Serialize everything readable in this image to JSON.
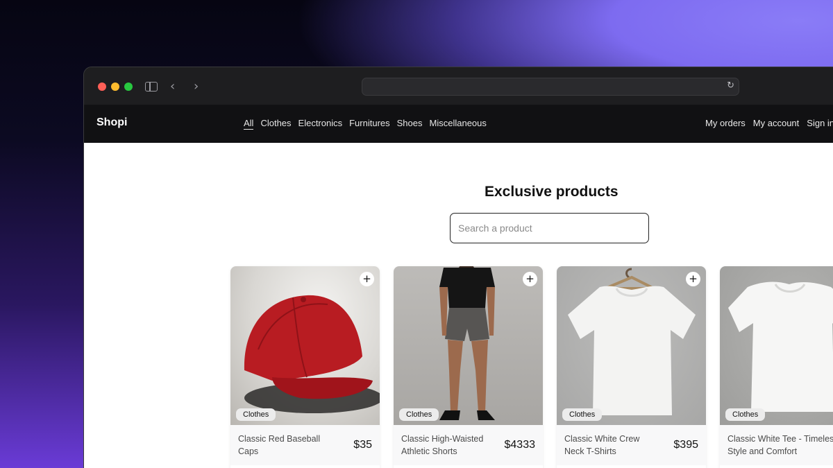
{
  "nav": {
    "logo": "Shopi",
    "categories": [
      {
        "label": "All",
        "active": true
      },
      {
        "label": "Clothes"
      },
      {
        "label": "Electronics"
      },
      {
        "label": "Furnitures"
      },
      {
        "label": "Shoes"
      },
      {
        "label": "Miscellaneous"
      }
    ],
    "account": [
      "My orders",
      "My account",
      "Sign in"
    ]
  },
  "main": {
    "title": "Exclusive products",
    "search_placeholder": "Search a product"
  },
  "products": [
    {
      "name": "Classic Red Baseball Caps",
      "price": "$35",
      "category": "Clothes",
      "image": "red-cap"
    },
    {
      "name": "Classic High-Waisted Athletic Shorts",
      "price": "$4333",
      "category": "Clothes",
      "image": "athletic-shorts"
    },
    {
      "name": "Classic White Crew Neck T-Shirts",
      "price": "$395",
      "category": "Clothes",
      "image": "white-crew-tshirt"
    },
    {
      "name": "Classic White Tee - Timeless Style and Comfort",
      "price": "",
      "category": "Clothes",
      "image": "white-tee"
    }
  ],
  "colors": {
    "nav_bg": "#111113",
    "traffic_red": "#ff5f57",
    "traffic_yellow": "#febc2e",
    "traffic_green": "#28c840"
  }
}
